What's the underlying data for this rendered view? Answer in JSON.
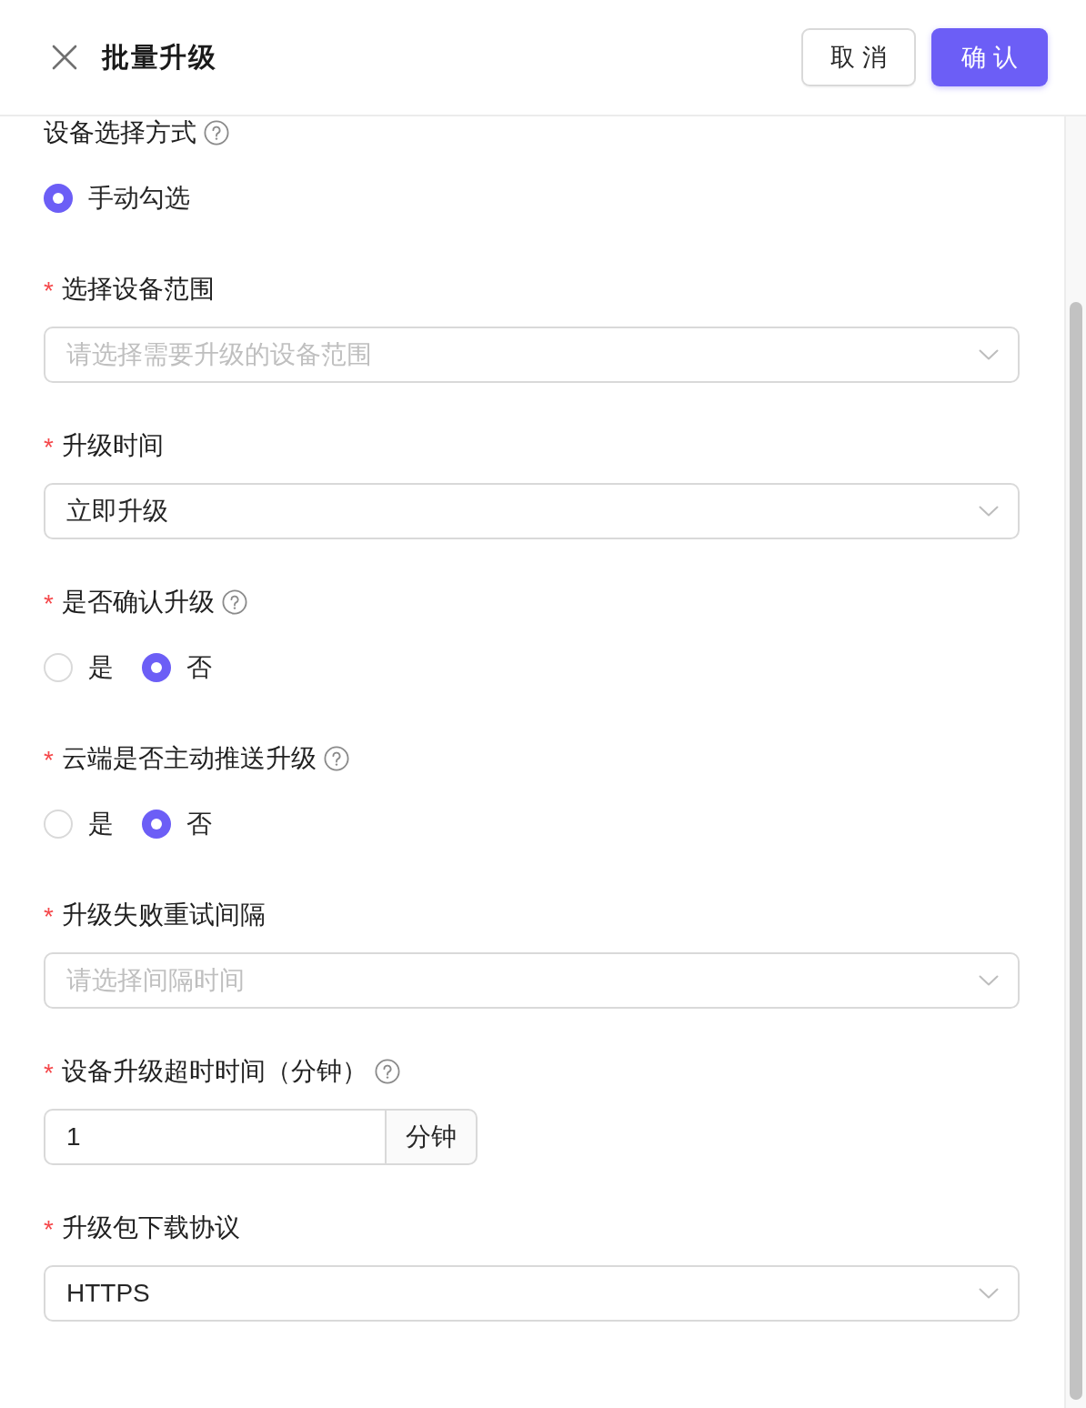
{
  "dialog": {
    "title": "批量升级",
    "buttons": [
      {
        "label": "取 消",
        "kind": "default"
      },
      {
        "label": "确 认",
        "kind": "primary"
      }
    ]
  },
  "form": {
    "fields": [
      {
        "kind": "radio",
        "label": "设备选择方式",
        "help": true,
        "options": [
          {
            "label": "手动勾选",
            "selected": true
          }
        ]
      },
      {
        "kind": "select",
        "required_mark": "*",
        "label": "选择设备范围",
        "help": false,
        "placeholder": "请选择需要升级的设备范围"
      },
      {
        "kind": "select",
        "required_mark": "*",
        "label": "升级时间",
        "help": false,
        "value": "立即升级"
      },
      {
        "kind": "radio",
        "required_mark": "*",
        "label": "是否确认升级",
        "help": true,
        "options": [
          {
            "label": "是",
            "selected": false
          },
          {
            "label": "否",
            "selected": true
          }
        ]
      },
      {
        "kind": "radio",
        "required_mark": "*",
        "label": "云端是否主动推送升级",
        "help": true,
        "options": [
          {
            "label": "是",
            "selected": false
          },
          {
            "label": "否",
            "selected": true
          }
        ]
      },
      {
        "kind": "select",
        "required_mark": "*",
        "label": "升级失败重试间隔",
        "help": false,
        "placeholder": "请选择间隔时间"
      },
      {
        "kind": "number",
        "required_mark": "*",
        "label": "设备升级超时时间（分钟）",
        "help": true,
        "value": "1",
        "addon": "分钟"
      },
      {
        "kind": "select",
        "required_mark": "*",
        "label": "升级包下载协议",
        "help": false,
        "value": "HTTPS"
      }
    ]
  }
}
